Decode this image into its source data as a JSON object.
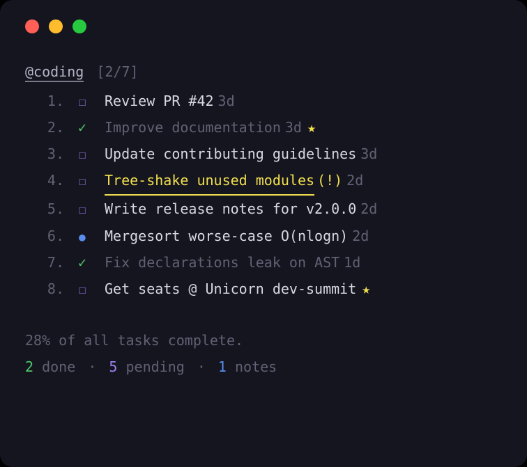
{
  "header": {
    "tag": "@coding",
    "counter": "[2/7]"
  },
  "tasks": [
    {
      "num": "1.",
      "status": "open",
      "text": "Review PR #42",
      "age": "3d",
      "starred": false,
      "highlighted": false,
      "priority": false
    },
    {
      "num": "2.",
      "status": "done",
      "text": "Improve documentation",
      "age": "3d",
      "starred": true,
      "highlighted": false,
      "priority": false
    },
    {
      "num": "3.",
      "status": "open",
      "text": "Update contributing guidelines",
      "age": "3d",
      "starred": false,
      "highlighted": false,
      "priority": false
    },
    {
      "num": "4.",
      "status": "open",
      "text": "Tree-shake unused modules",
      "age": "2d",
      "starred": false,
      "highlighted": true,
      "priority": true
    },
    {
      "num": "5.",
      "status": "open",
      "text": "Write release notes for v2.0.0",
      "age": "2d",
      "starred": false,
      "highlighted": false,
      "priority": false
    },
    {
      "num": "6.",
      "status": "note",
      "text": "Mergesort worse-case O(nlogn)",
      "age": "2d",
      "starred": false,
      "highlighted": false,
      "priority": false
    },
    {
      "num": "7.",
      "status": "done",
      "text": "Fix declarations leak on AST",
      "age": "1d",
      "starred": false,
      "highlighted": false,
      "priority": false
    },
    {
      "num": "8.",
      "status": "open",
      "text": "Get seats @ Unicorn dev-summit",
      "age": "",
      "starred": true,
      "highlighted": false,
      "priority": false
    }
  ],
  "footer": {
    "progress_line": "28% of all tasks complete.",
    "done_count": "2",
    "done_label": " done",
    "pending_count": "5",
    "pending_label": " pending",
    "notes_count": "1",
    "notes_label": " notes",
    "separator": "·"
  },
  "glyphs": {
    "checkbox": "☐",
    "check": "✓",
    "bullet": "●",
    "star": "★",
    "priority": "(!)"
  }
}
